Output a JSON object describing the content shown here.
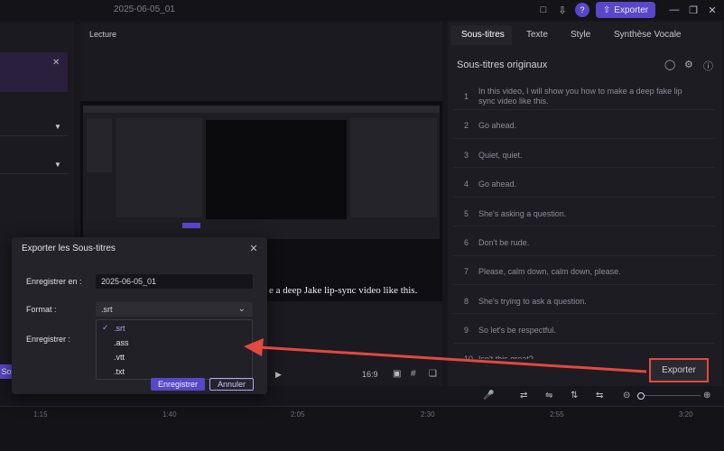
{
  "topbar": {
    "project_name": "2025-06-05_01",
    "export_label": "Exporter",
    "icons": [
      "comment-icon",
      "download-icon",
      "help-icon",
      "upload-icon",
      "minimize-icon",
      "restore-icon",
      "close-icon"
    ]
  },
  "preview": {
    "title": "Lecture",
    "subtitle_overlay": "e a deep Jake lip-sync video like this.",
    "ratio": "16:9"
  },
  "right_panel": {
    "tabs": [
      "Sous-titres",
      "Texte",
      "Style",
      "Synthèse Vocale"
    ],
    "heading": "Sous-titres originaux",
    "subtitles": [
      {
        "num": "1",
        "text": "In this video, I will show you how to make a deep fake lip sync video like this."
      },
      {
        "num": "2",
        "text": "Go ahead."
      },
      {
        "num": "3",
        "text": "Quiet, quiet."
      },
      {
        "num": "4",
        "text": "Go ahead."
      },
      {
        "num": "5",
        "text": "She's asking a question."
      },
      {
        "num": "6",
        "text": "Don't be rude."
      },
      {
        "num": "7",
        "text": "Please, calm down, calm down, please."
      },
      {
        "num": "8",
        "text": "She's trying to ask a question."
      },
      {
        "num": "9",
        "text": "So let's be respectful."
      },
      {
        "num": "10",
        "text": "Isn't this great?"
      }
    ],
    "export_label": "Exporter"
  },
  "dialog": {
    "title": "Exporter les Sous-titres",
    "save_in_label": "Enregistrer en :",
    "save_in_value": "2025-06-05_01",
    "format_label": "Format :",
    "format_value": ".srt",
    "save_label": "Enregistrer :",
    "format_options": [
      ".srt",
      ".ass",
      ".vtt",
      ".txt"
    ],
    "save_button": "Enregistrer",
    "cancel_button": "Annuler"
  },
  "left_panel": {
    "tag": "So"
  },
  "timeline": {
    "ticks": [
      "1:15",
      "1:40",
      "2:05",
      "2:30",
      "2:55",
      "3:20"
    ]
  },
  "colors": {
    "accent": "#5a46c8",
    "annotation_red": "#e2493f"
  }
}
